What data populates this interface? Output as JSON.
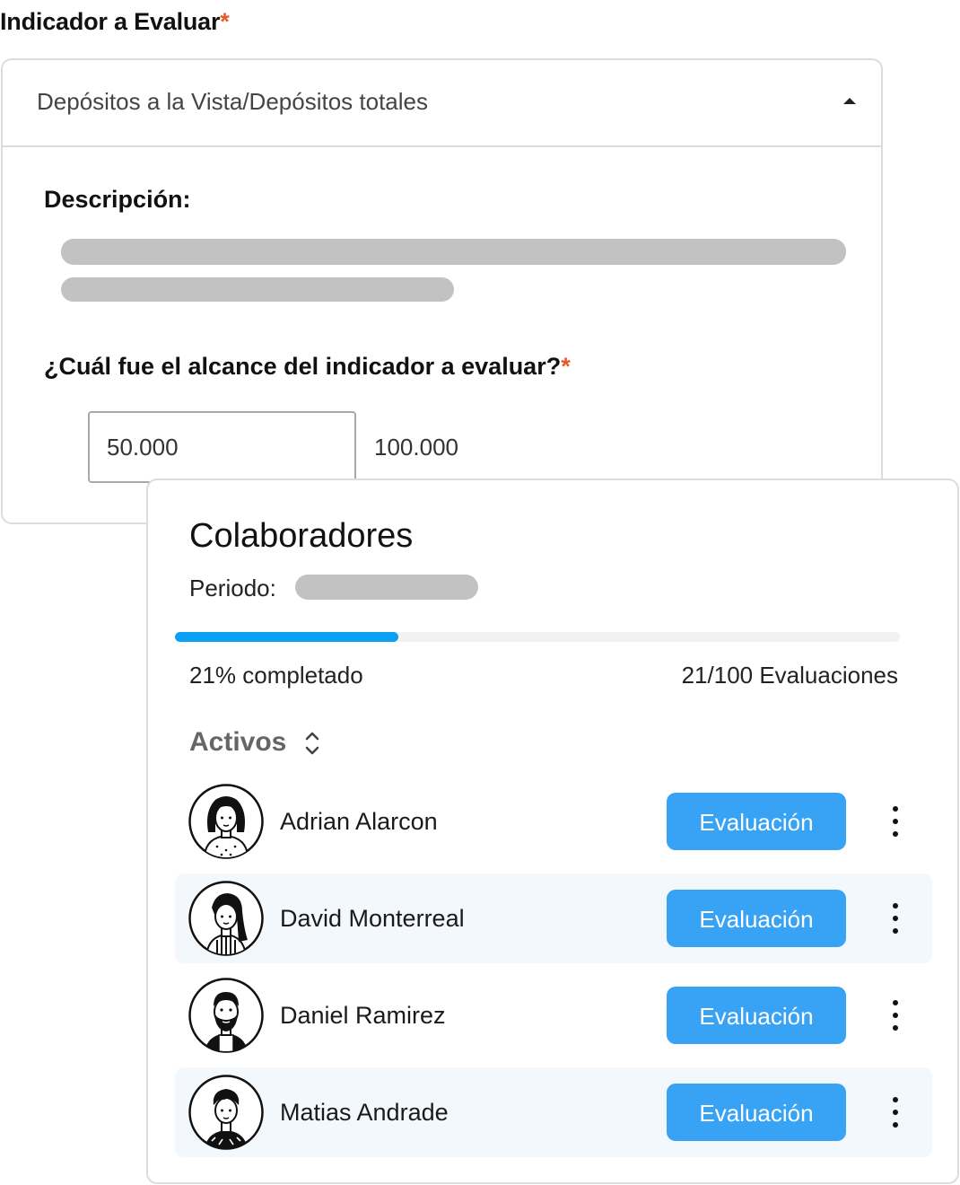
{
  "indicator": {
    "title": "Indicador a Evaluar",
    "required_mark": "*",
    "selected": "Depósitos a la Vista/Depósitos totales",
    "description_label": "Descripción:",
    "question": "¿Cuál fue el alcance del indicador a evaluar?",
    "question_required_mark": "*",
    "range_value": "50.000",
    "range_max": "100.000"
  },
  "collaborators": {
    "title": "Colaboradores",
    "period_label": "Periodo:",
    "progress_percent": 21,
    "progress_text": "21% completado",
    "progress_count": "21/100 Evaluaciones",
    "filter_label": "Activos",
    "button_label": "Evaluación",
    "people": [
      {
        "name": "Adrian Alarcon",
        "avatar": "woman-bob-hair-avatar"
      },
      {
        "name": "David Monterreal",
        "avatar": "woman-long-hair-avatar"
      },
      {
        "name": "Daniel Ramirez",
        "avatar": "bearded-man-avatar"
      },
      {
        "name": "Matias Andrade",
        "avatar": "young-man-avatar"
      }
    ]
  },
  "colors": {
    "accent": "#38a3f5",
    "progress": "#0aa0f4",
    "required": "#e8572a"
  }
}
